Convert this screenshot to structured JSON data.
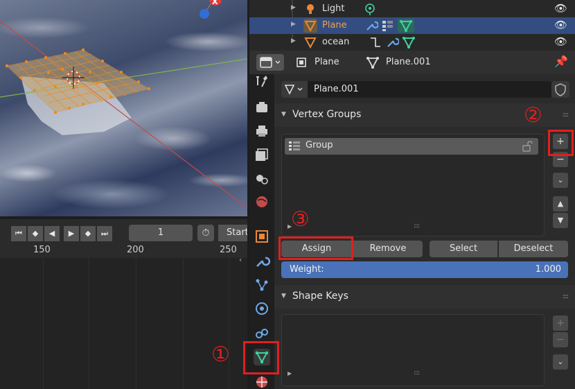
{
  "viewport": {
    "axis_label": "X"
  },
  "timeline": {
    "current_frame": "1",
    "start_label": "Start",
    "ticks": [
      "150",
      "200",
      "250"
    ]
  },
  "outliner": {
    "rows": [
      {
        "name": "Light",
        "selected": false
      },
      {
        "name": "Plane",
        "selected": true
      },
      {
        "name": "ocean",
        "selected": false
      }
    ]
  },
  "properties": {
    "header": {
      "object_name": "Plane",
      "data_name": "Plane.001"
    },
    "mesh_name": "Plane.001",
    "vertex_groups": {
      "title": "Vertex Groups",
      "items": [
        "Group"
      ],
      "add_label": "+",
      "remove_label": "−",
      "assign_label": "Assign",
      "remove_btn_label": "Remove",
      "select_label": "Select",
      "deselect_label": "Deselect",
      "weight_label": "Weight:",
      "weight_value": "1.000"
    },
    "shape_keys": {
      "title": "Shape Keys"
    }
  },
  "annotations": {
    "one": "①",
    "two": "②",
    "three": "③"
  },
  "colors": {
    "accent_red": "#e02020",
    "selection_blue": "#334d80",
    "weight_blue": "#4a72b8",
    "mesh_green": "#3fd3a0",
    "object_orange": "#e8883a"
  }
}
